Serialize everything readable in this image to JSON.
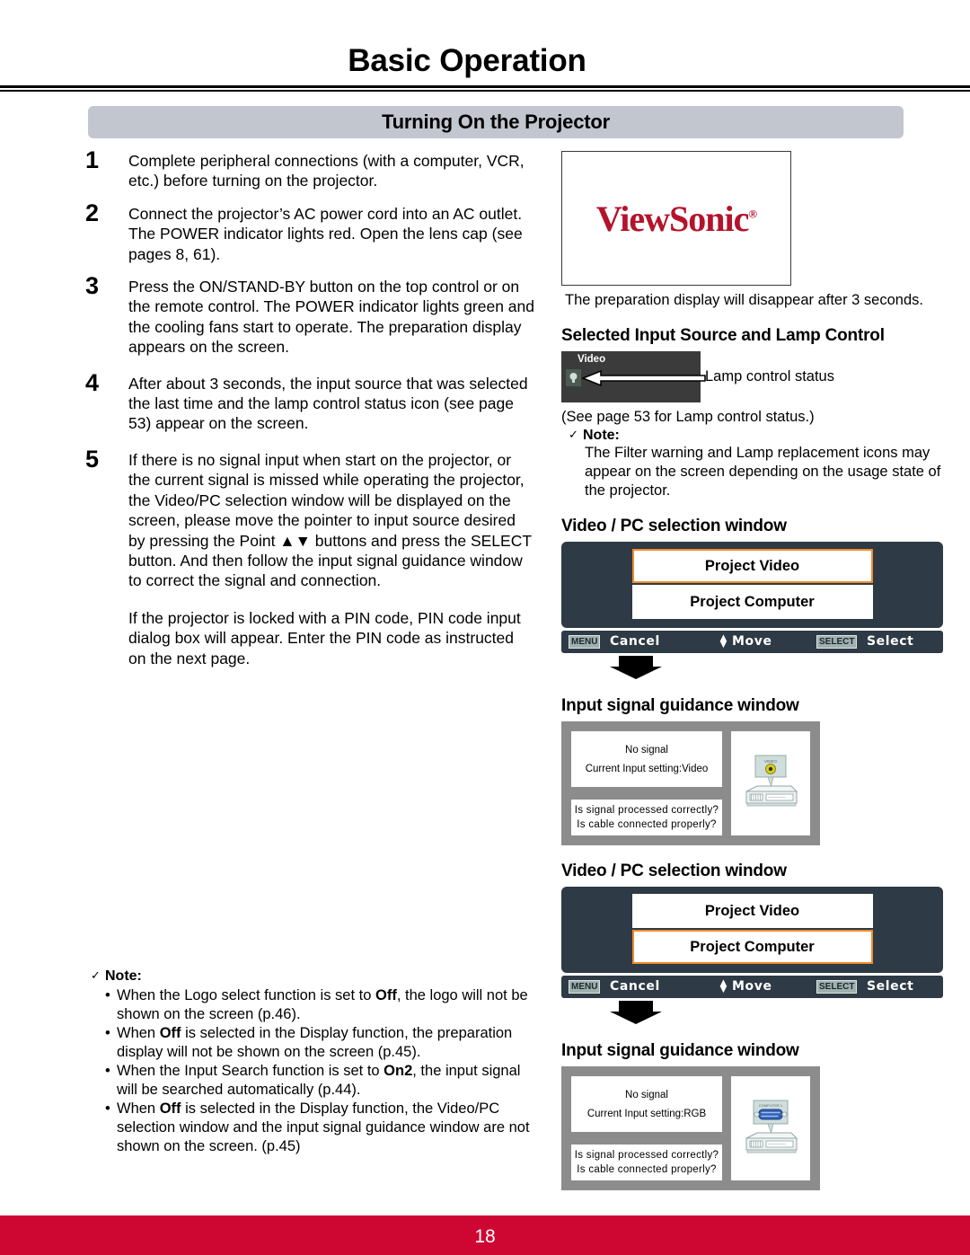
{
  "header": {
    "title": "Basic Operation",
    "section": "Turning On the Projector"
  },
  "steps": [
    {
      "num": "1",
      "paragraphs": [
        "Complete peripheral connections (with a computer, VCR, etc.) before turning on the projector."
      ]
    },
    {
      "num": "2",
      "paragraphs": [
        "Connect the projector’s AC power cord into an AC outlet. The POWER indicator lights red. Open the lens cap (see pages 8, 61)."
      ]
    },
    {
      "num": "3",
      "paragraphs": [
        "Press the ON/STAND-BY button on the top control or on the remote control. The POWER indicator lights green and the cooling fans start to operate. The preparation display appears on the screen."
      ]
    },
    {
      "num": "4",
      "paragraphs": [
        "After about 3 seconds, the input source that was selected the last time and the lamp control status icon (see page 53) appear on the screen."
      ]
    },
    {
      "num": "5",
      "paragraphs": [
        "If there is no signal input when start on the projector, or the current signal is missed while operating the projector, the Video/PC selection window will be displayed on the screen, please move the pointer to input source desired by pressing the Point ▲▼ buttons and press the SELECT button. And then follow the input signal guidance window to correct the signal and connection.",
        "If the projector is locked with a PIN code, PIN code input dialog box will appear. Enter the PIN code as instructed on the next page."
      ]
    }
  ],
  "left_note": {
    "check": "✓",
    "heading": "Note:",
    "items": [
      "When the Logo select function is set to Off, the logo will not be shown on the screen (p.46).",
      "When Off is selected in the Display function, the preparation display will not be shown on the screen (p.45).",
      "When the Input Search function is set to On2, the input signal will be searched automatically (p.44).",
      "When Off is selected in the Display function, the Video/PC selection window and the input signal guidance window are not shown on the screen. (p.45)"
    ]
  },
  "right": {
    "logo_text": "ViewSonic",
    "logo_mark": "®",
    "logo_color": "#b5122c",
    "prep_caption": "The preparation display will disappear after 3 seconds.",
    "lamp_heading": "Selected Input Source and Lamp Control",
    "lamp_osd_label": "Video",
    "lamp_arrow_label": "Lamp control status",
    "lamp_see_page": "(See page 53 for Lamp control status.)",
    "lamp_note": {
      "check": "✓",
      "heading": "Note:",
      "body": "The Filter warning and Lamp replacement icons may appear on the screen depending on the usage state of the projector."
    },
    "selection_window_1": {
      "heading": "Video / PC selection window",
      "items": [
        {
          "label": "Project Video",
          "selected": true
        },
        {
          "label": "Project Computer",
          "selected": false
        }
      ],
      "bar": {
        "menu_key": "MENU",
        "menu_label": "Cancel",
        "move_label": "Move",
        "select_key": "SELECT",
        "select_label": "Select"
      },
      "highlight_color": "#f08b2b"
    },
    "guidance_window_1": {
      "heading": "Input signal guidance window",
      "line1": "No signal",
      "line2": "Current Input setting:Video",
      "question1": "Is signal processed correctly?",
      "question2": "Is cable connected properly?",
      "device_icon": "vcr-video-input-icon",
      "device_port_label": "VIDEO"
    },
    "selection_window_2": {
      "heading": "Video / PC selection window",
      "items": [
        {
          "label": "Project Video",
          "selected": false
        },
        {
          "label": "Project Computer",
          "selected": true
        }
      ],
      "bar": {
        "menu_key": "MENU",
        "menu_label": "Cancel",
        "move_label": "Move",
        "select_key": "SELECT",
        "select_label": "Select"
      },
      "highlight_color": "#f08b2b"
    },
    "guidance_window_2": {
      "heading": "Input signal guidance window",
      "line1": "No signal",
      "line2": "Current Input setting:RGB",
      "question1": "Is signal processed correctly?",
      "question2": "Is cable connected properly?",
      "device_icon": "computer-vga-input-icon",
      "device_port_label": "COMPUTER 1"
    }
  },
  "footer": {
    "page_number": "18",
    "bar_color": "#ce0632"
  }
}
